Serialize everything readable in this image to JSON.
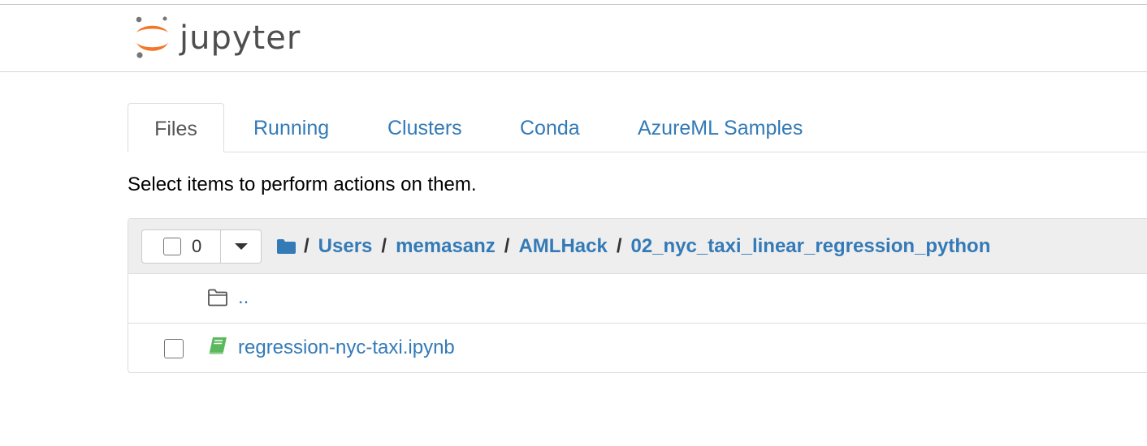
{
  "header": {
    "logo_text": "jupyter"
  },
  "tabs": [
    {
      "label": "Files",
      "active": true
    },
    {
      "label": "Running",
      "active": false
    },
    {
      "label": "Clusters",
      "active": false
    },
    {
      "label": "Conda",
      "active": false
    },
    {
      "label": "AzureML Samples",
      "active": false
    }
  ],
  "instructions": "Select items to perform actions on them.",
  "file_list": {
    "selected_count": "0",
    "breadcrumb": {
      "separator": "/",
      "items": [
        "Users",
        "memasanz",
        "AMLHack",
        "02_nyc_taxi_linear_regression_python"
      ]
    },
    "rows": [
      {
        "name": "..",
        "type": "parent-folder",
        "icon": "folder-open-icon"
      },
      {
        "name": "regression-nyc-taxi.ipynb",
        "type": "notebook",
        "icon": "notebook-icon"
      }
    ]
  },
  "colors": {
    "link": "#337ab7",
    "logo_orange": "#f37726",
    "logo_gray": "#767677",
    "notebook_green": "#5cb85c",
    "breadcrumb_folder": "#337ab7"
  }
}
